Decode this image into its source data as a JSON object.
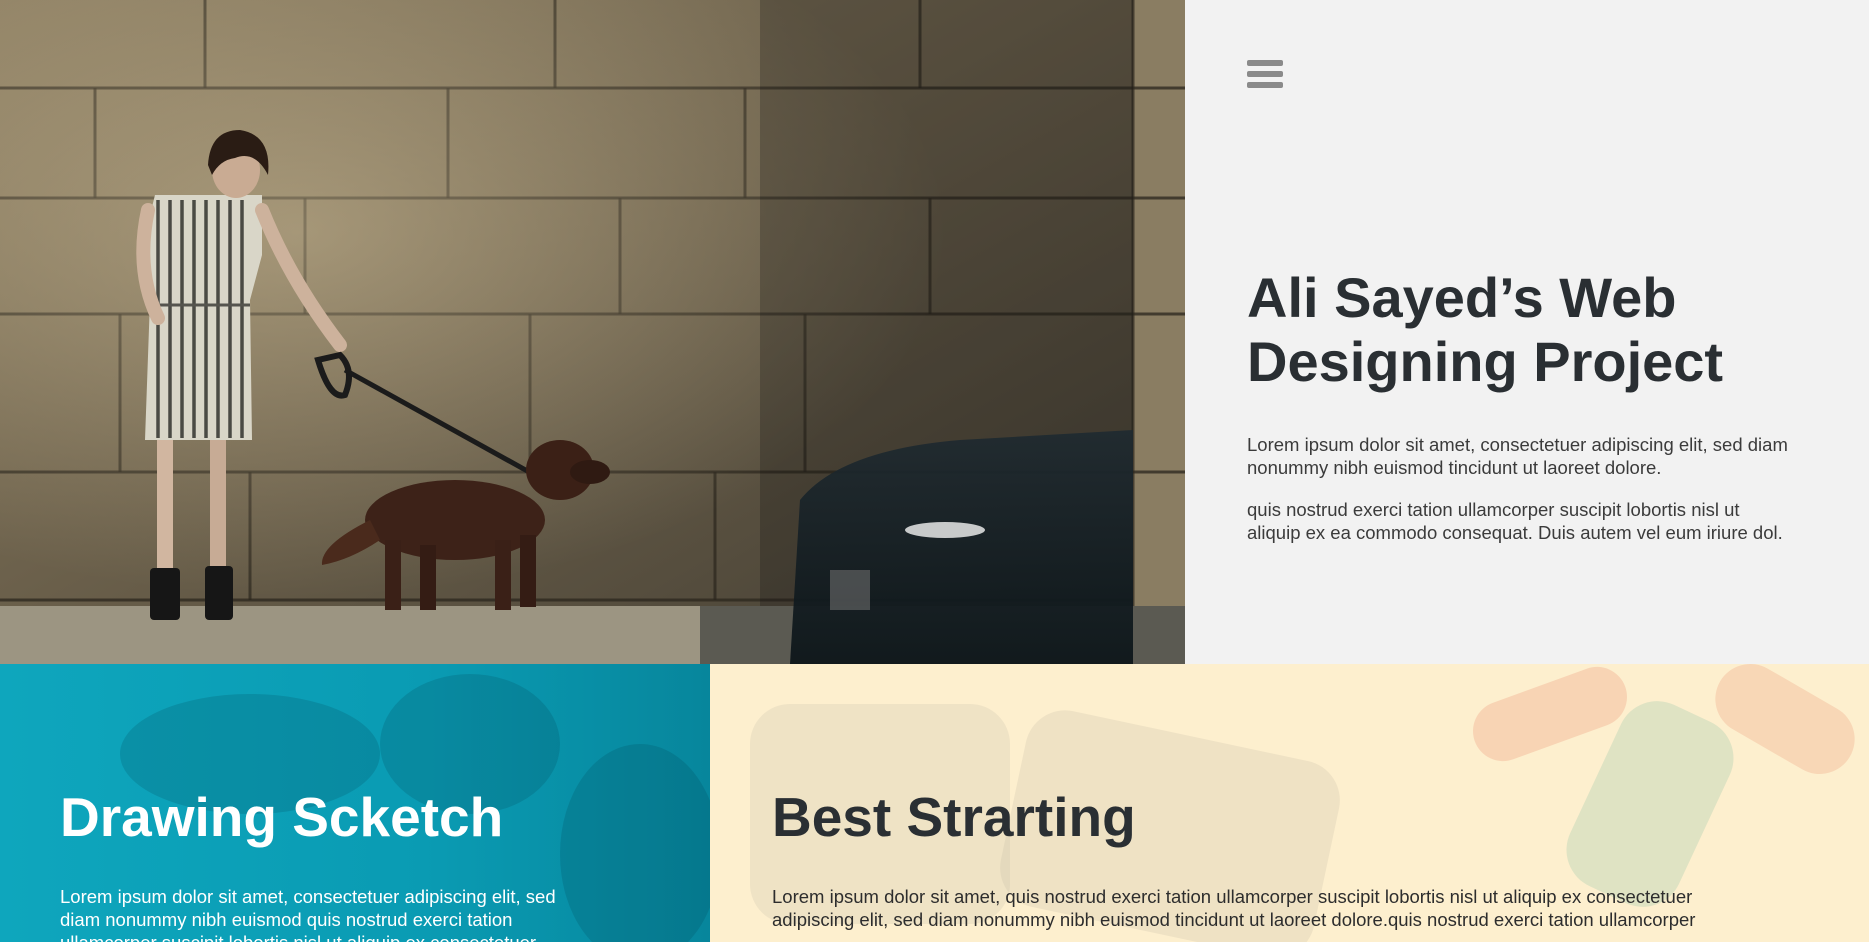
{
  "hero": {
    "image_description": "woman-walking-dog-stone-wall",
    "menu_icon": "hamburger-menu-icon",
    "title": "Ali Sayed’s Web Designing Project",
    "paragraph_1": "Lorem ipsum dolor sit amet, consectetuer adipiscing elit, sed diam nonummy nibh euismod tincidunt ut laoreet dolore.",
    "paragraph_2": "quis nostrud exerci tation ullamcorper suscipit lobortis nisl ut aliquip ex ea commodo consequat. Duis autem vel eum iriure dol."
  },
  "sections": {
    "drawing": {
      "title": "Drawing Scketch",
      "text": "Lorem ipsum dolor sit amet, consectetuer adipiscing elit, sed diam nonummy nibh euismod quis nostrud exerci tation ullamcorper suscipit lobortis nisl ut aliquip ex consectetuer",
      "accent": "#0ea6bd"
    },
    "starting": {
      "title": "Best Strarting",
      "text": "Lorem ipsum dolor sit amet, quis nostrud exerci tation ullamcorper suscipit lobortis nisl ut aliquip ex consectetuer adipiscing elit, sed diam nonummy nibh euismod tincidunt ut laoreet dolore.quis nostrud exerci tation ullamcorper",
      "accent": "#fdefce"
    }
  },
  "colors": {
    "panel_bg": "#f2f2f2",
    "heading": "#2a2f33",
    "menu_icon": "#8a8a8a"
  }
}
